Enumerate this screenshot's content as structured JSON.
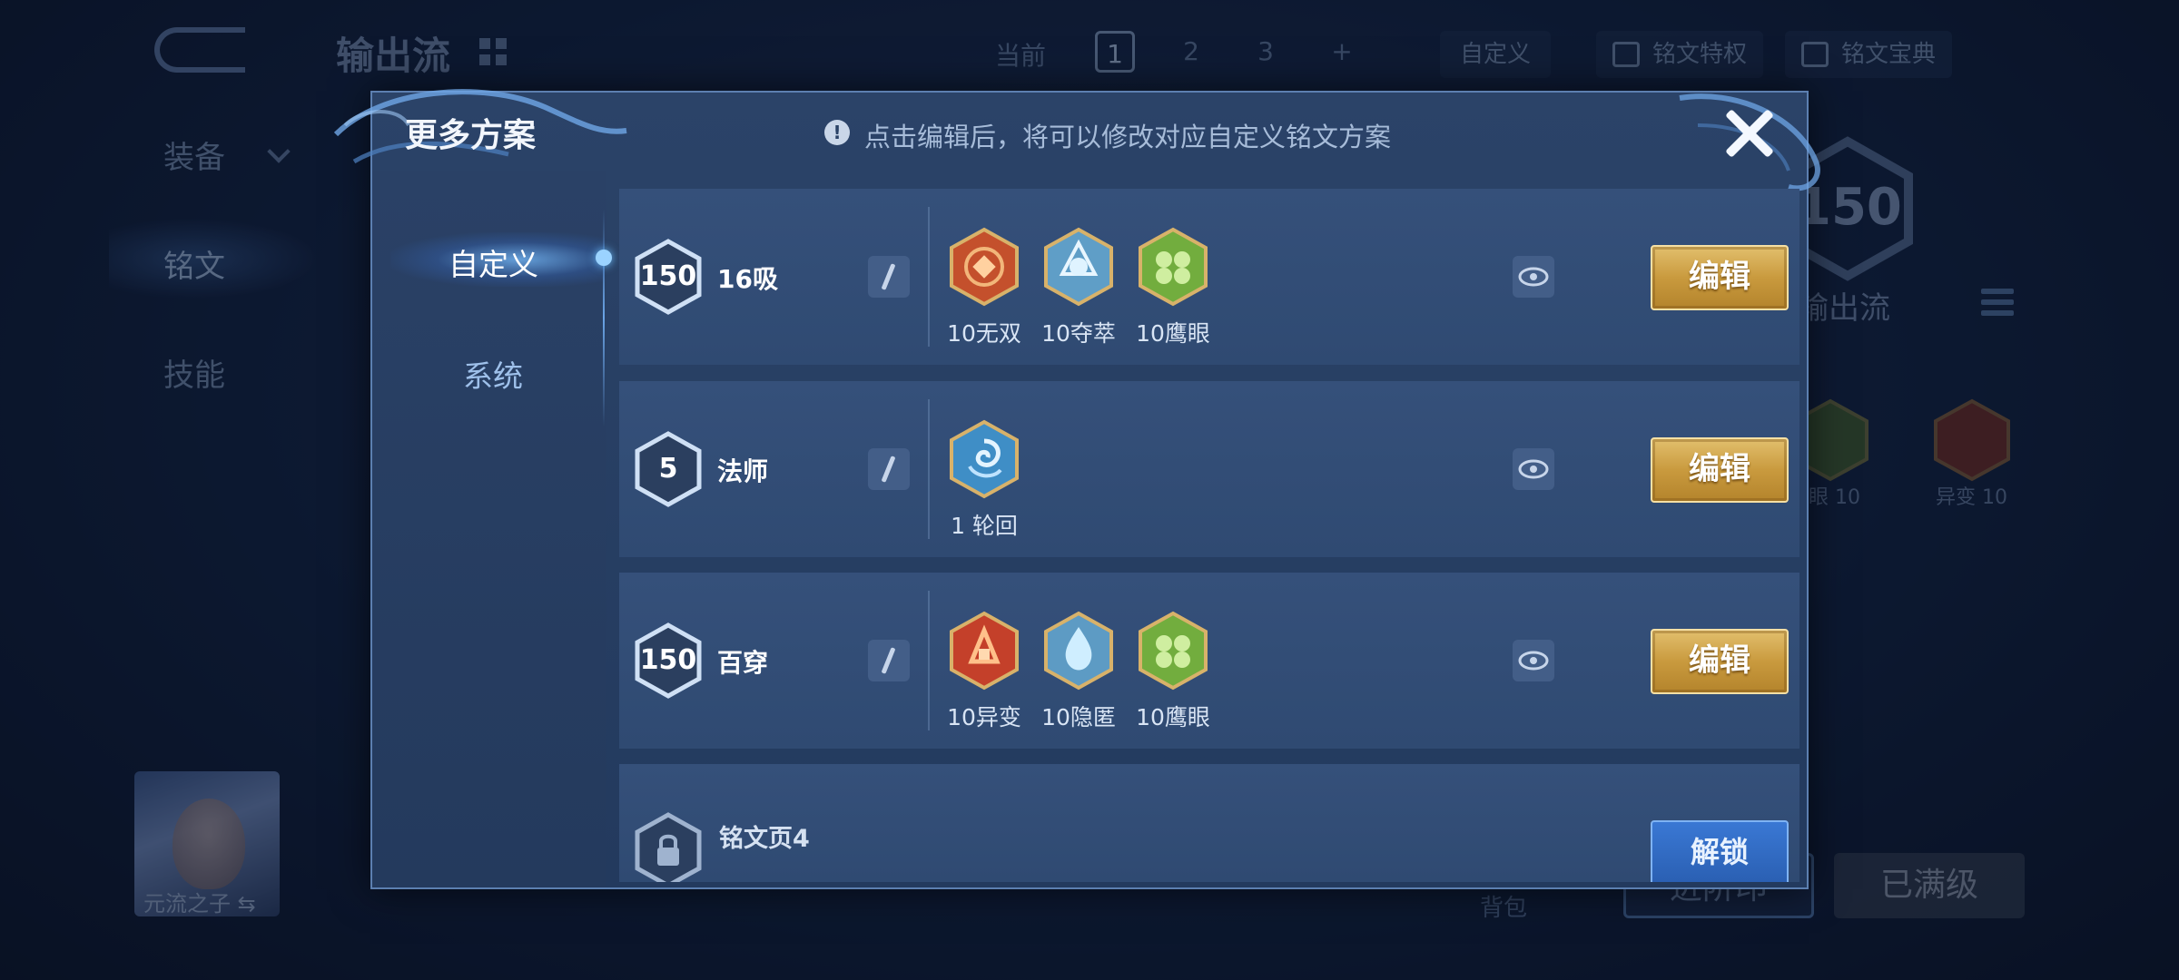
{
  "background": {
    "title": "输出流",
    "nav": [
      "装备",
      "铭文",
      "技能"
    ],
    "tabs": {
      "current_label": "当前",
      "pages": [
        "1",
        "2",
        "3"
      ],
      "add": "+"
    },
    "custom_button": "自定义",
    "traits_button": "铭文特权",
    "guide_button": "铭文宝典",
    "level_value": "150",
    "scheme_name": "输出流",
    "gem_labels": [
      "鹰眼 10",
      "异变 10"
    ],
    "hero_name": "元流之子",
    "swap_icon": "⇆",
    "bag_label": "背包",
    "buttons": [
      "进阶印",
      "已满级"
    ]
  },
  "modal": {
    "title": "更多方案",
    "hint": "点击编辑后，将可以修改对应自定义铭文方案",
    "tabs": {
      "custom": "自定义",
      "system": "系统"
    },
    "rows": [
      {
        "level": "150",
        "name": "16吸",
        "gems": [
          "10无双",
          "10夺萃",
          "10鹰眼"
        ],
        "edit": "编辑"
      },
      {
        "level": "5",
        "name": "法师",
        "gems": [
          "1 轮回"
        ],
        "edit": "编辑"
      },
      {
        "level": "150",
        "name": "百穿",
        "gems": [
          "10异变",
          "10隐匿",
          "10鹰眼"
        ],
        "edit": "编辑"
      },
      {
        "name": "铭文页4",
        "unlock": "解锁"
      }
    ]
  },
  "colors": {
    "gem_red": "#d2542a",
    "gem_ice": "#8fd0ec",
    "gem_green": "#7cb84a",
    "gem_swirl": "#4aa0d8",
    "edit_gold": "#d2aa55"
  }
}
